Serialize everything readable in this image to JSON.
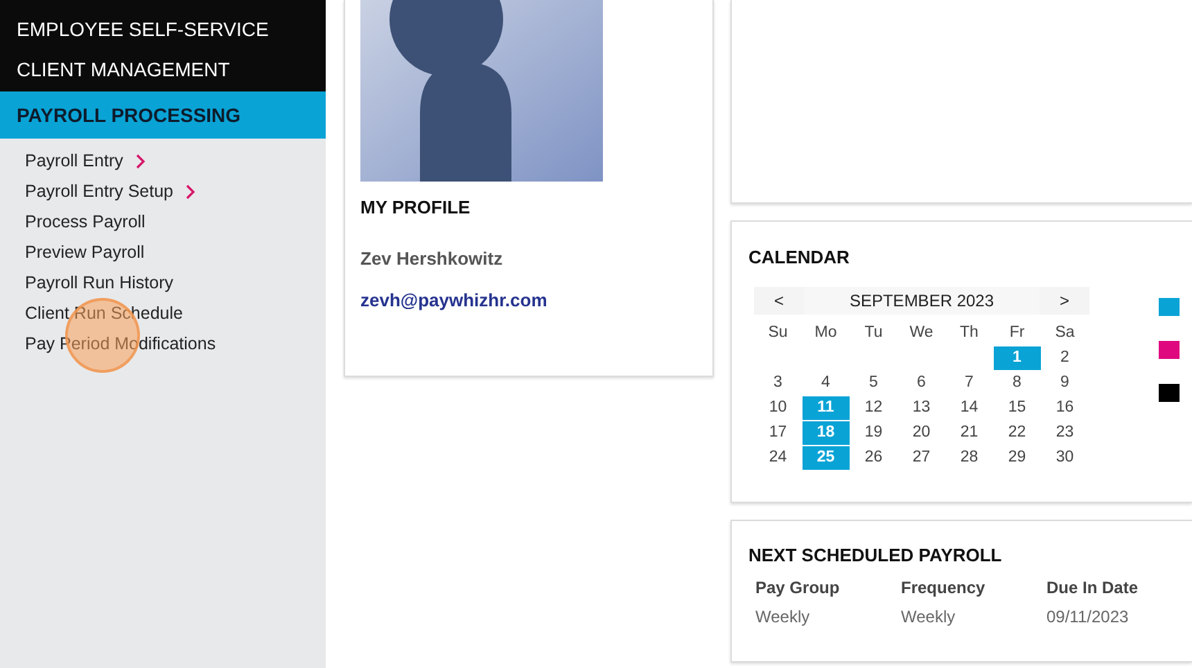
{
  "sidebar": {
    "sections": [
      {
        "label": "EMPLOYEE SELF-SERVICE",
        "selected": false
      },
      {
        "label": "CLIENT MANAGEMENT",
        "selected": false
      },
      {
        "label": "PAYROLL PROCESSING",
        "selected": true
      }
    ],
    "items": [
      {
        "label": "Payroll Entry",
        "has_submenu": true
      },
      {
        "label": "Payroll Entry Setup",
        "has_submenu": true
      },
      {
        "label": "Process Payroll",
        "has_submenu": false
      },
      {
        "label": "Preview Payroll",
        "has_submenu": false
      },
      {
        "label": "Payroll Run History",
        "has_submenu": false
      },
      {
        "label": "Client Run Schedule",
        "has_submenu": false
      },
      {
        "label": "Pay Period Modifications",
        "has_submenu": false
      }
    ]
  },
  "profile": {
    "title": "MY PROFILE",
    "name": "Zev Hershkowitz",
    "email": "zevh@paywhizhr.com"
  },
  "calendar": {
    "title": "CALENDAR",
    "prev": "<",
    "month": "SEPTEMBER 2023",
    "next": ">",
    "weekdays": [
      "Su",
      "Mo",
      "Tu",
      "We",
      "Th",
      "Fr",
      "Sa"
    ],
    "weeks": [
      [
        {
          "label": "1",
          "selected": true
        },
        {
          "label": "2",
          "selected": false
        }
      ],
      [
        {
          "label": "3",
          "selected": false
        },
        {
          "label": "4",
          "selected": false
        },
        {
          "label": "5",
          "selected": false
        },
        {
          "label": "6",
          "selected": false
        },
        {
          "label": "7",
          "selected": false
        },
        {
          "label": "8",
          "selected": false
        },
        {
          "label": "9",
          "selected": false
        }
      ],
      [
        {
          "label": "10",
          "selected": false
        },
        {
          "label": "11",
          "selected": true
        },
        {
          "label": "12",
          "selected": false
        },
        {
          "label": "13",
          "selected": false
        },
        {
          "label": "14",
          "selected": false
        },
        {
          "label": "15",
          "selected": false
        },
        {
          "label": "16",
          "selected": false
        }
      ],
      [
        {
          "label": "17",
          "selected": false
        },
        {
          "label": "18",
          "selected": true
        },
        {
          "label": "19",
          "selected": false
        },
        {
          "label": "20",
          "selected": false
        },
        {
          "label": "21",
          "selected": false
        },
        {
          "label": "22",
          "selected": false
        },
        {
          "label": "23",
          "selected": false
        }
      ],
      [
        {
          "label": "24",
          "selected": false
        },
        {
          "label": "25",
          "selected": true
        },
        {
          "label": "26",
          "selected": false
        },
        {
          "label": "27",
          "selected": false
        },
        {
          "label": "28",
          "selected": false
        },
        {
          "label": "29",
          "selected": false
        },
        {
          "label": "30",
          "selected": false
        }
      ]
    ],
    "legend": [
      {
        "color": "#0aa3d6"
      },
      {
        "color": "#e0087f"
      },
      {
        "color": "#000000"
      }
    ]
  },
  "next_payroll": {
    "title": "NEXT SCHEDULED PAYROLL",
    "columns": [
      "Pay Group",
      "Frequency",
      "Due In Date"
    ],
    "rows": [
      [
        "Weekly",
        "Weekly",
        "09/11/2023"
      ]
    ]
  }
}
